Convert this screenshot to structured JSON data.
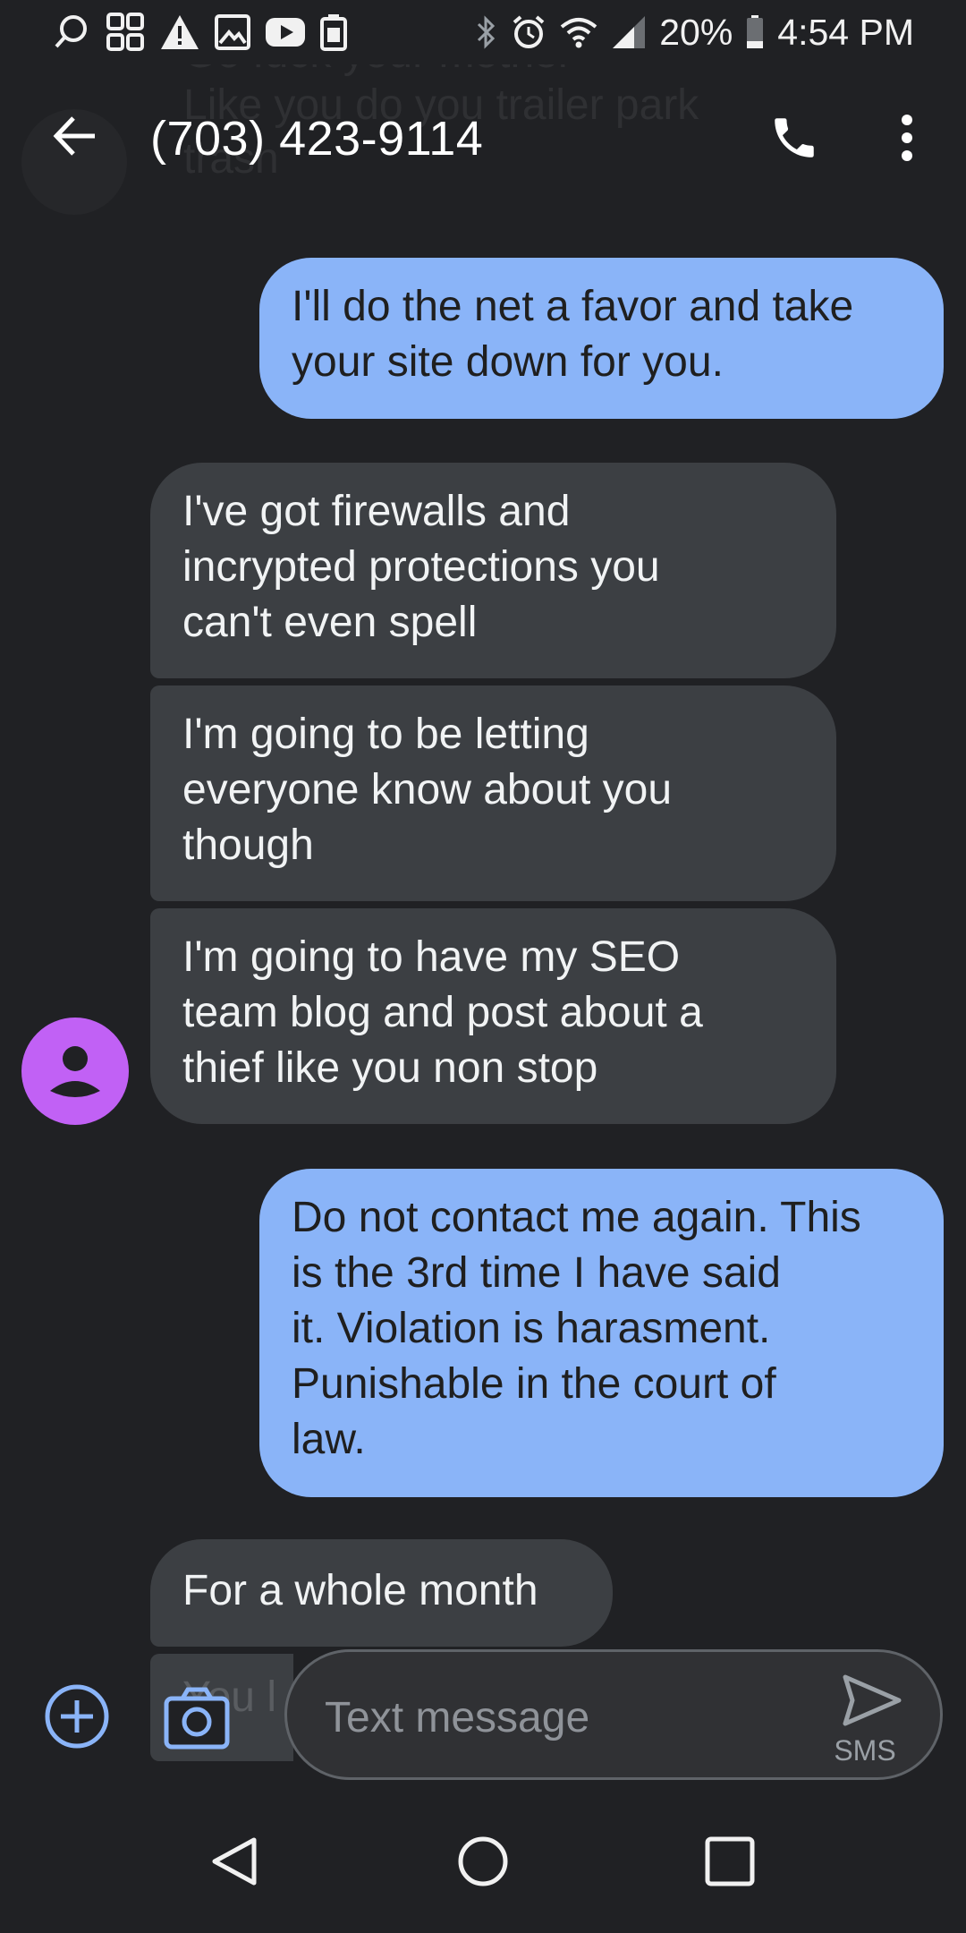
{
  "status_bar": {
    "battery_percent": "20%",
    "time": "4:54 PM",
    "left_icons": [
      "search-status-icon",
      "grid-app-icon",
      "warning-icon",
      "image-icon",
      "youtube-icon",
      "sim-icon"
    ],
    "right_icons": [
      "bluetooth-icon",
      "alarm-icon",
      "wifi-icon",
      "cell-signal-icon",
      "battery-icon"
    ]
  },
  "app_bar": {
    "title": "(703) 423-9114",
    "ghost_line_1": "Go fuck your mother",
    "ghost_line_2": "Like you do you trailer park",
    "ghost_line_3": "trash"
  },
  "messages": [
    {
      "direction": "out",
      "text": "I'll do the net a favor and take\nyour site down for you."
    },
    {
      "direction": "in",
      "text": "I've got firewalls and\nincrypted protections you\ncan't even spell"
    },
    {
      "direction": "in",
      "text": "I'm going to be letting\neveryone know about you\nthough"
    },
    {
      "direction": "in",
      "text": "I'm going to have my SEO\nteam blog and post about a\nthief like you non stop"
    },
    {
      "direction": "out",
      "text": "Do not contact me again. This\nis the 3rd time I have said\nit. Violation is harasment.\nPunishable in the court of\nlaw."
    },
    {
      "direction": "in",
      "text": "For a whole month"
    },
    {
      "direction": "in",
      "text": "You l"
    }
  ],
  "composer": {
    "placeholder": "Text message",
    "send_label": "SMS"
  },
  "colors": {
    "background": "#202124",
    "outgoing_bubble": "#8ab4f8",
    "incoming_bubble": "#3c3f43",
    "avatar": "#c161f5",
    "accent": "#8ab4f8"
  }
}
